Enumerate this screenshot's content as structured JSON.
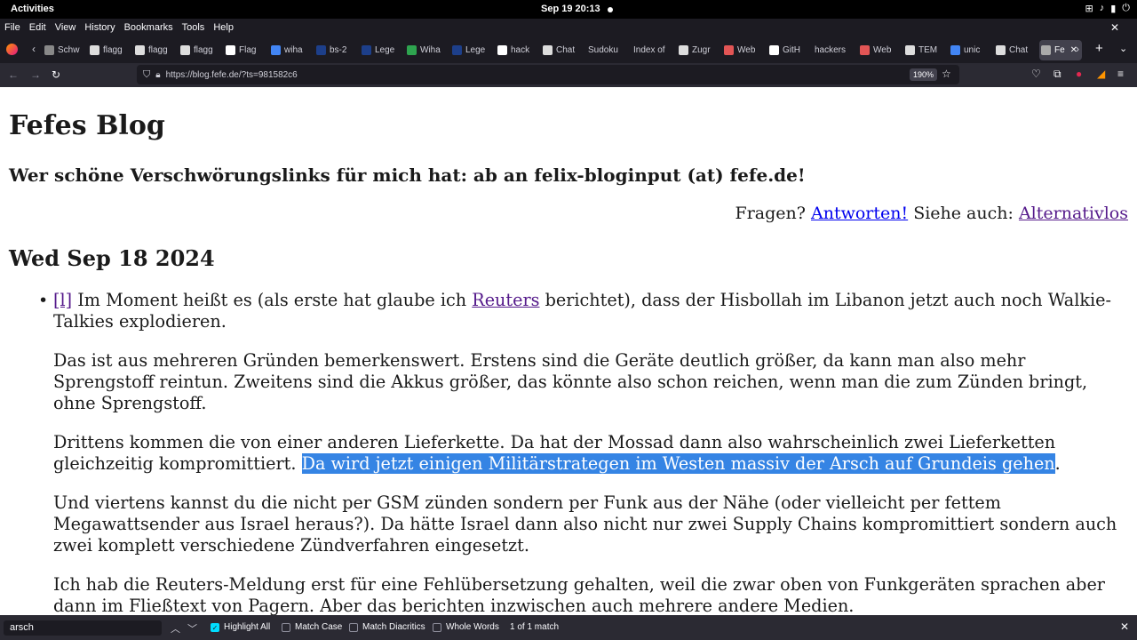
{
  "topbar": {
    "activities": "Activities",
    "clock": "Sep 19  20:13"
  },
  "menubar": {
    "items": [
      "File",
      "Edit",
      "View",
      "History",
      "Bookmarks",
      "Tools",
      "Help"
    ]
  },
  "tabs": [
    {
      "title": "Schw",
      "color": "#888888"
    },
    {
      "title": "flagg",
      "color": "#dddddd"
    },
    {
      "title": "flagg",
      "color": "#dddddd"
    },
    {
      "title": "flagg",
      "color": "#dddddd"
    },
    {
      "title": "Flag",
      "color": "#ffffff"
    },
    {
      "title": "wiha",
      "color": "#4285f4"
    },
    {
      "title": "bs-2",
      "color": "#1d3f8a"
    },
    {
      "title": "Lege",
      "color": "#1d3f8a"
    },
    {
      "title": "Wiha",
      "color": "#2ea44f"
    },
    {
      "title": "Lege",
      "color": "#1d3f8a"
    },
    {
      "title": "hack",
      "color": "#ffffff"
    },
    {
      "title": "Chat",
      "color": "#dddddd"
    },
    {
      "title": "Sudoku",
      "color": ""
    },
    {
      "title": "Index of",
      "color": ""
    },
    {
      "title": "Zugr",
      "color": "#dddddd"
    },
    {
      "title": "Web",
      "color": "#e25555"
    },
    {
      "title": "GitH",
      "color": "#ffffff"
    },
    {
      "title": "hackers",
      "color": ""
    },
    {
      "title": "Web",
      "color": "#e25555"
    },
    {
      "title": "TEM",
      "color": "#dddddd"
    },
    {
      "title": "unic",
      "color": "#4285f4"
    },
    {
      "title": "Chat",
      "color": "#dddddd"
    },
    {
      "title": "Fe",
      "color": "#aaaaaa",
      "active": true
    }
  ],
  "navbar": {
    "url": "https://blog.fefe.de/?ts=981582c6",
    "zoom": "190%"
  },
  "page": {
    "title": "Fefes Blog",
    "subtitle": "Wer schöne Verschwörungslinks für mich hat: ab an felix-bloginput (at) fefe.de!",
    "questions": "Fragen?",
    "answers_link": "Antworten!",
    "see_also": "Siehe auch:",
    "alternativlos_link": "Alternativlos",
    "date": "Wed Sep 18 2024",
    "post": {
      "permalink": "[l]",
      "p1_a": "Im Moment heißt es (als erste hat glaube ich",
      "p1_link": "Reuters",
      "p1_b": "berichtet), dass der Hisbollah im Libanon jetzt auch noch Walkie-Talkies explodieren.",
      "p2": "Das ist aus mehreren Gründen bemerkenswert. Erstens sind die Geräte deutlich größer, da kann man also mehr Sprengstoff reintun. Zweitens sind die Akkus größer, das könnte also schon reichen, wenn man die zum Zünden bringt, ohne Sprengstoff.",
      "p3_a": "Drittens kommen die von einer anderen Lieferkette. Da hat der Mossad dann also wahrscheinlich zwei Lieferketten gleichzeitig kompromittiert.",
      "p3_highlight": "Da wird jetzt einigen Militärstrategen im Westen massiv der Arsch auf Grundeis gehen",
      "p3_end": ".",
      "p4": "Und viertens kannst du die nicht per GSM zünden sondern per Funk aus der Nähe (oder vielleicht per fettem Megawattsender aus Israel heraus?). Da hätte Israel dann also nicht nur zwei Supply Chains kompromittiert sondern auch zwei komplett verschiedene Zündverfahren eingesetzt.",
      "p5": "Ich hab die Reuters-Meldung erst für eine Fehlübersetzung gehalten, weil die zwar oben von Funkgeräten sprachen aber dann im Fließtext von Pagern. Aber das berichten inzwischen auch mehrere andere Medien."
    }
  },
  "findbar": {
    "query": "arsch",
    "highlight_all": "Highlight All",
    "match_case": "Match Case",
    "match_diacritics": "Match Diacritics",
    "whole_words": "Whole Words",
    "status": "1 of 1 match"
  }
}
